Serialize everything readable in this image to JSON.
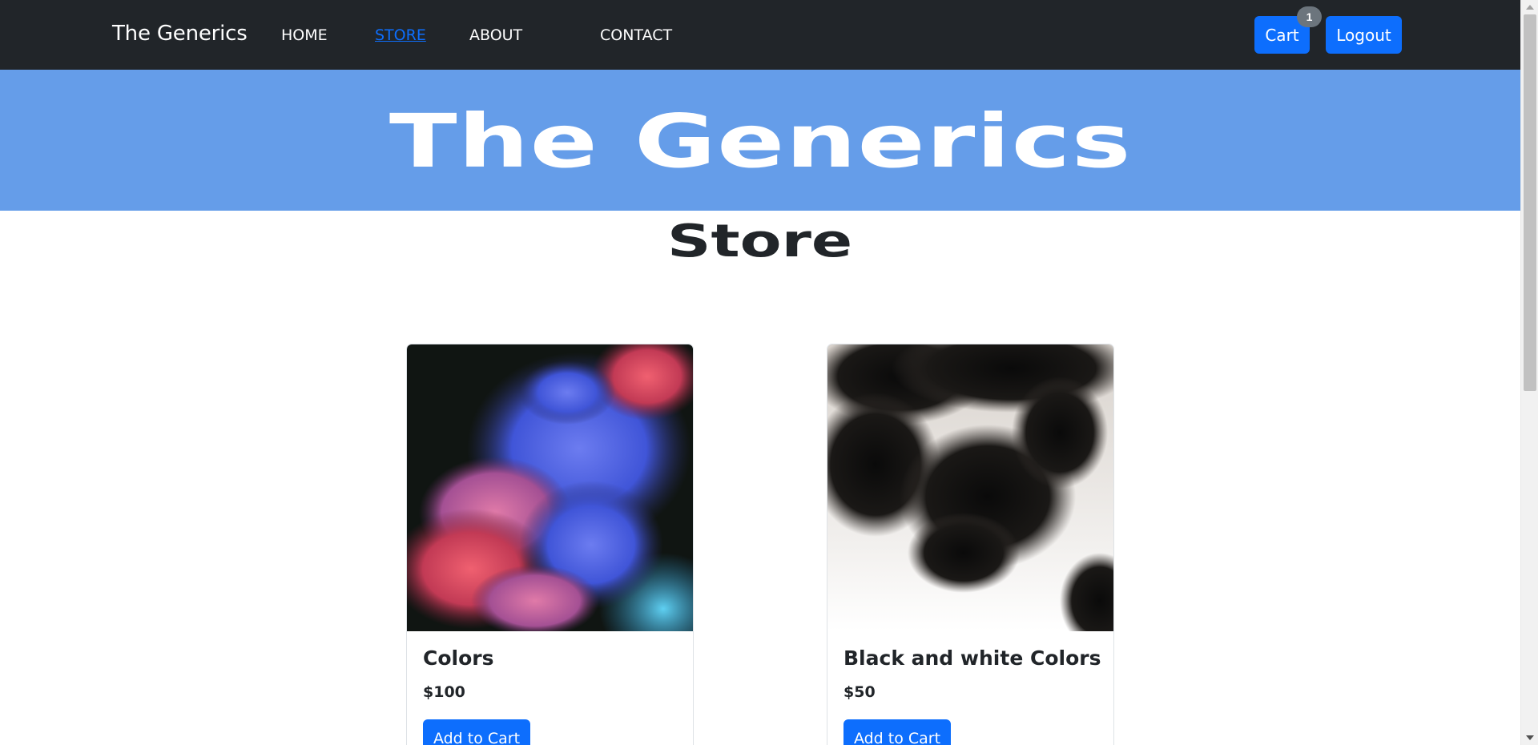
{
  "navbar": {
    "brand": "The Generics",
    "links": [
      {
        "label": "HOME"
      },
      {
        "label": "STORE",
        "active": true
      },
      {
        "label": "ABOUT"
      },
      {
        "label": "CONTACT"
      }
    ],
    "cart_label": "Cart",
    "cart_count": "1",
    "logout_label": "Logout"
  },
  "hero": {
    "title": "The Generics"
  },
  "section": {
    "title": "Store"
  },
  "products": [
    {
      "title": "Colors",
      "price": "$100",
      "button": "Add to Cart",
      "image": "colorful-smoke-image"
    },
    {
      "title": "Black and white Colors",
      "price": "$50",
      "button": "Add to Cart",
      "image": "black-ink-image"
    }
  ],
  "colors": {
    "navbar_bg": "#212529",
    "hero_bg": "#659de9",
    "primary": "#0d6efd",
    "badge": "#6c757d"
  }
}
